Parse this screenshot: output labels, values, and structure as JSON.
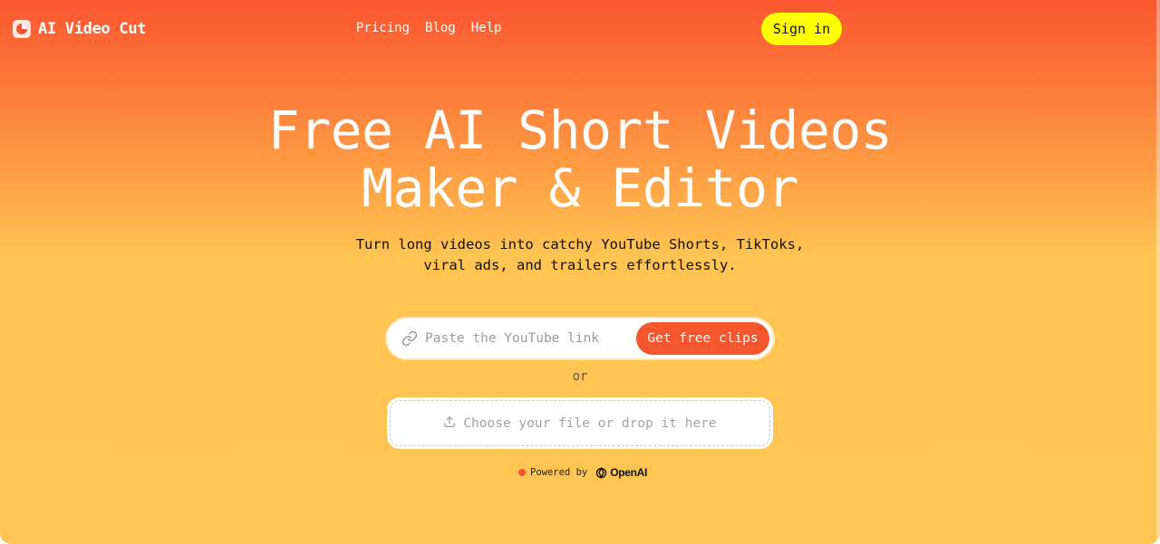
{
  "brand": {
    "name": "AI Video Cut",
    "logo_icon": "circle-cut-icon"
  },
  "nav": {
    "items": [
      {
        "label": "Pricing"
      },
      {
        "label": "Blog"
      },
      {
        "label": "Help"
      }
    ],
    "sign_in_label": "Sign in"
  },
  "hero": {
    "headline_line1": "Free AI Short Videos",
    "headline_line2": "Maker & Editor",
    "subhead_line1": "Turn long videos into catchy YouTube Shorts, TikToks,",
    "subhead_line2": "viral ads, and trailers effortlessly."
  },
  "link_form": {
    "placeholder": "Paste the YouTube link",
    "value": "",
    "button_label": "Get free clips",
    "icon": "link-icon"
  },
  "or_label": "or",
  "upload": {
    "label": "Choose your file or drop it here",
    "icon": "upload-icon"
  },
  "powered_by": {
    "label": "Powered by",
    "provider": "OpenAI",
    "status_color": "#f4562d"
  },
  "colors": {
    "gradient_top": "#fb5630",
    "gradient_bottom": "#ffc553",
    "accent": "#f4562d",
    "sign_in_bg": "#ffff00"
  }
}
